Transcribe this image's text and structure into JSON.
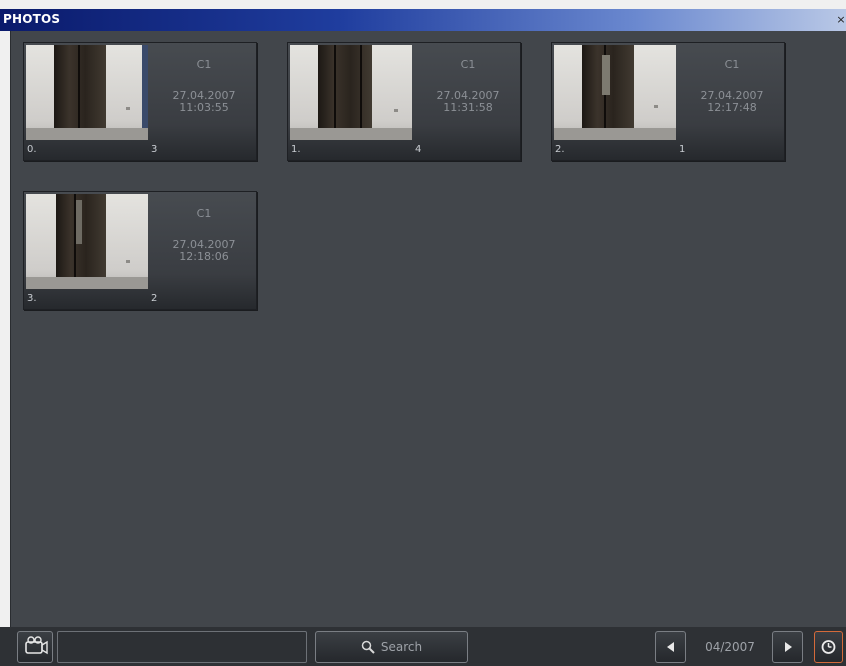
{
  "window": {
    "title": "PHOTOS",
    "close_glyph": "×"
  },
  "photos": [
    {
      "index": "0.",
      "count": "3",
      "camera": "C1",
      "date": "27.04.2007",
      "time": "11:03:55"
    },
    {
      "index": "1.",
      "count": "4",
      "camera": "C1",
      "date": "27.04.2007",
      "time": "11:31:58"
    },
    {
      "index": "2.",
      "count": "1",
      "camera": "C1",
      "date": "27.04.2007",
      "time": "12:17:48"
    },
    {
      "index": "3.",
      "count": "2",
      "camera": "C1",
      "date": "27.04.2007",
      "time": "12:18:06"
    }
  ],
  "toolbar": {
    "camera_icon": "camera-icon",
    "search_value": "",
    "search_label": "Search",
    "search_icon": "magnifier-icon",
    "prev_icon": "arrow-left-icon",
    "date": "04/2007",
    "next_icon": "arrow-right-icon",
    "clock_icon": "clock-icon"
  },
  "colors": {
    "titlebar_start": "#0a1a6b",
    "content_bg": "#42464b",
    "thumb_text": "#8c9096",
    "clock_accent": "#d46a3a"
  }
}
